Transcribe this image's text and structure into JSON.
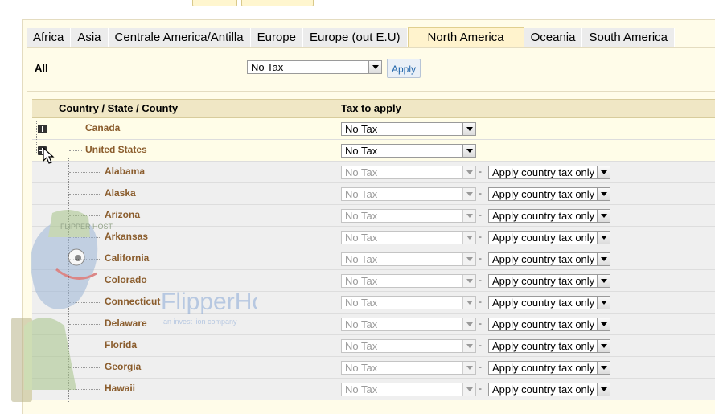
{
  "tabs": [
    "Africa",
    "Asia",
    "Centrale America/Antilla",
    "Europe",
    "Europe (out E.U)",
    "North America",
    "Oceania",
    "South America"
  ],
  "active_tab": "North America",
  "all_bar": {
    "label": "All",
    "select_value": "No Tax",
    "apply_label": "Apply"
  },
  "table": {
    "col_country": "Country / State / County",
    "col_tax": "Tax to apply",
    "countries": [
      {
        "name": "Canada",
        "tax": "No Tax"
      },
      {
        "name": "United States",
        "tax": "No Tax"
      }
    ],
    "states": [
      "Alabama",
      "Alaska",
      "Arizona",
      "Arkansas",
      "California",
      "Colorado",
      "Connecticut",
      "Delaware",
      "Florida",
      "Georgia",
      "Hawaii"
    ],
    "state_tax": "No Tax",
    "state_mode": "Apply country tax only"
  },
  "watermark": {
    "brand": "FlipperHost",
    "tagline": "an invest lion company",
    "cap": "FLIPPER HOST"
  }
}
